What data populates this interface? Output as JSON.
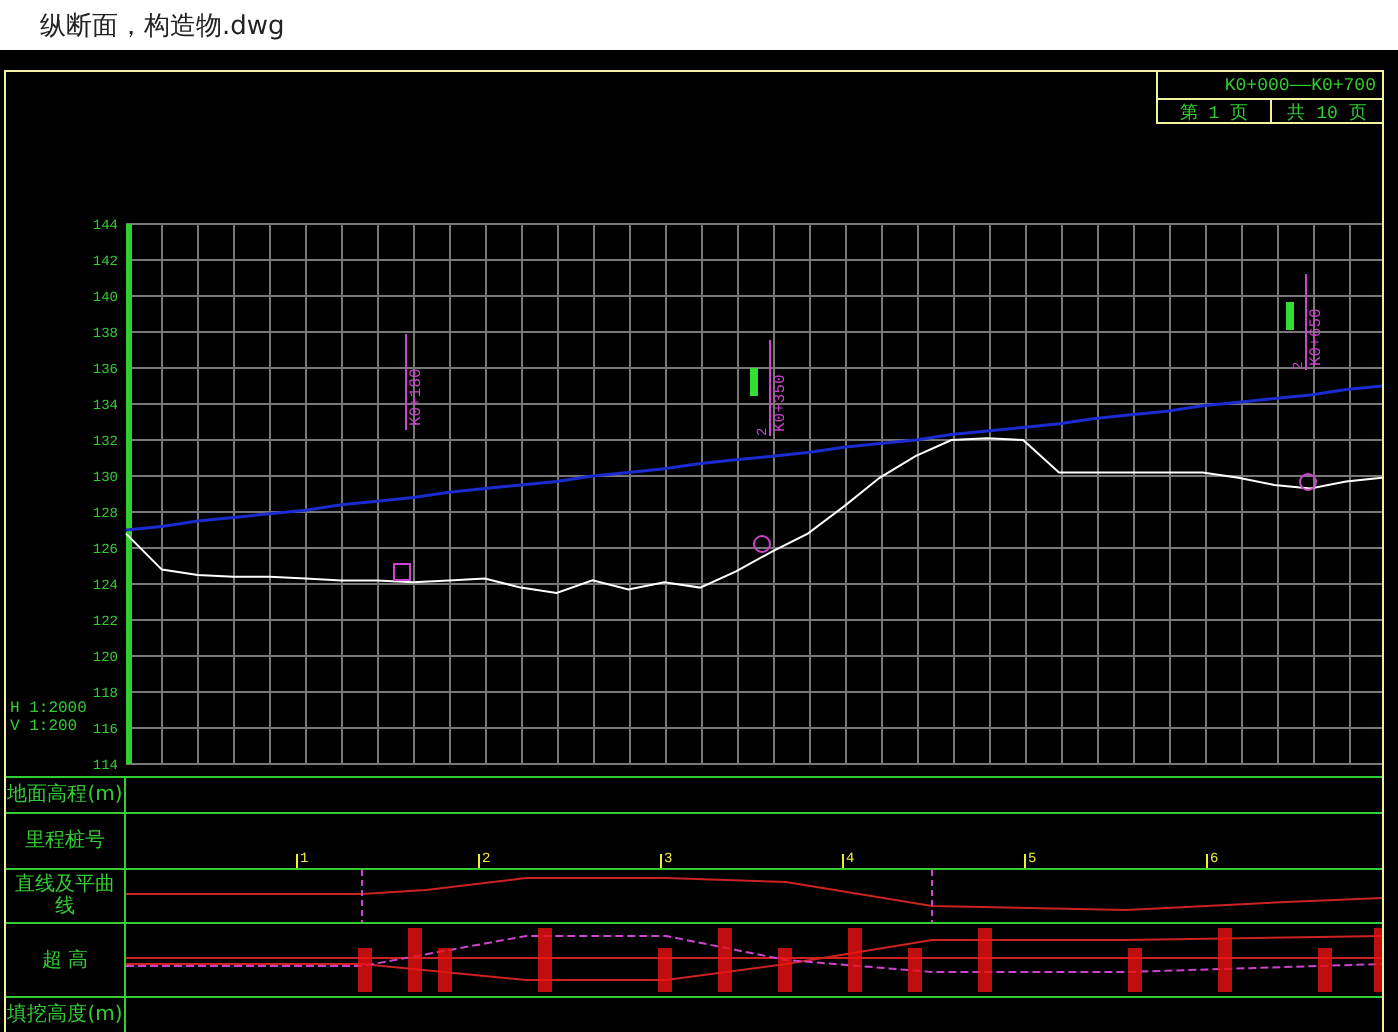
{
  "file": {
    "title": "纵断面，构造物.dwg"
  },
  "sheet": {
    "range": "K0+000——K0+700",
    "page": "第 1 页",
    "total": "共 10 页"
  },
  "profile": {
    "scale": [
      "H 1:2000",
      "V 1:200"
    ],
    "chart_data": {
      "type": "line",
      "grid": true,
      "categories": [
        null,
        null,
        null,
        null,
        null,
        null,
        null,
        null,
        null,
        null,
        null,
        null,
        null,
        null,
        null,
        null,
        null,
        null,
        null,
        null,
        null,
        null,
        null,
        null,
        null,
        null,
        null,
        null,
        null,
        null,
        null,
        null,
        null,
        null,
        null,
        null
      ],
      "ylim": [
        114,
        144
      ],
      "yticks": [
        144,
        142,
        140,
        138,
        136,
        134,
        132,
        130,
        128,
        126,
        124,
        122,
        120,
        118,
        116,
        114
      ],
      "series": [
        {
          "color": "#ffffff",
          "values": [
            126.8,
            124.8,
            124.5,
            124.4,
            124.4,
            124.3,
            124.2,
            124.2,
            124.1,
            124.2,
            124.3,
            123.8,
            123.5,
            124.2,
            123.7,
            124.1,
            123.8,
            124.7,
            125.8,
            126.8,
            128.3,
            129.9,
            131.1,
            132.0,
            132.1,
            132.0,
            130.2,
            130.2,
            130.2,
            130.2,
            130.2,
            129.9,
            129.5,
            129.3,
            129.7,
            129.9
          ]
        },
        {
          "color": "#1a2bd0",
          "values": [
            127.0,
            127.2,
            127.5,
            127.7,
            127.9,
            128.1,
            128.4,
            128.6,
            128.8,
            129.1,
            129.3,
            129.5,
            129.7,
            130.0,
            130.2,
            130.4,
            130.7,
            130.9,
            131.1,
            131.3,
            131.6,
            131.8,
            132.0,
            132.3,
            132.5,
            132.7,
            132.9,
            133.2,
            133.4,
            133.6,
            133.9,
            134.1,
            134.3,
            134.5,
            134.8,
            135.0
          ]
        }
      ]
    },
    "structures": [
      {
        "station": "K0+180"
      },
      {
        "station": "K0+350",
        "count": "2"
      },
      {
        "station": "K0+650",
        "count": "2"
      }
    ]
  },
  "table": {
    "rows": [
      {
        "label": "地面高程(m)",
        "kind": "values"
      },
      {
        "label": "里程桩号",
        "kind": "stations"
      },
      {
        "label": "直线及平曲线",
        "kind": "alignment"
      },
      {
        "label": "超 高",
        "kind": "superelevation"
      },
      {
        "label": "填挖高度(m)",
        "kind": "values"
      }
    ],
    "station_marks": [
      "1",
      "2",
      "3",
      "4",
      "5",
      "6"
    ]
  }
}
